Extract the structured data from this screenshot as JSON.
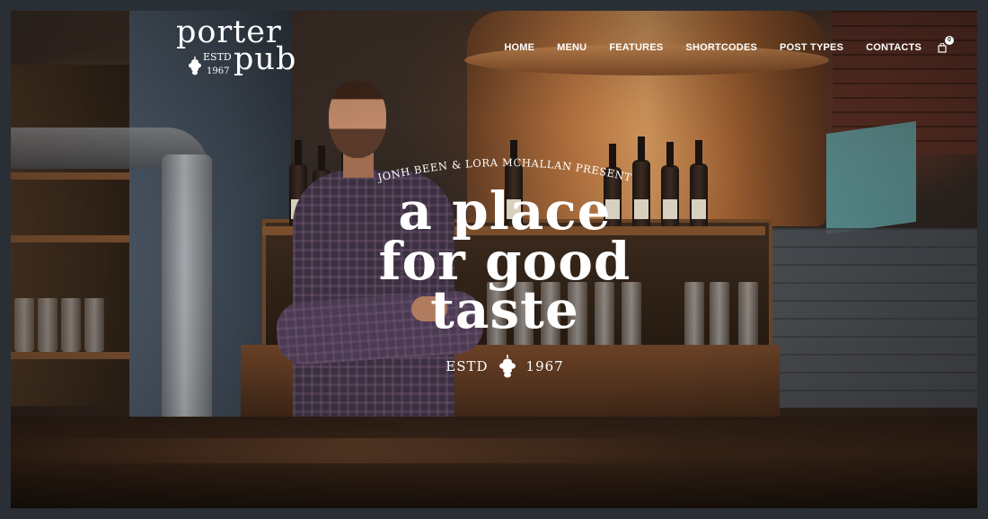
{
  "logo": {
    "word1": "porter",
    "word2": "pub",
    "estd": "ESTD",
    "year": "1967"
  },
  "nav": {
    "items": [
      "HOME",
      "MENU",
      "FEATURES",
      "SHORTCODES",
      "POST TYPES",
      "CONTACTS"
    ],
    "cart_count": "0"
  },
  "hero": {
    "presenters": "JONH BEEN & LORA MCHALLAN PRESENT",
    "line1": "a place",
    "line2": "for good",
    "line3": "taste",
    "estd": "ESTD",
    "year": "1967"
  },
  "icons": {
    "cart": "shopping-bag-icon",
    "logo_hop": "hop-icon"
  },
  "colors": {
    "text": "#ffffff",
    "frame": "#2a2f35"
  }
}
